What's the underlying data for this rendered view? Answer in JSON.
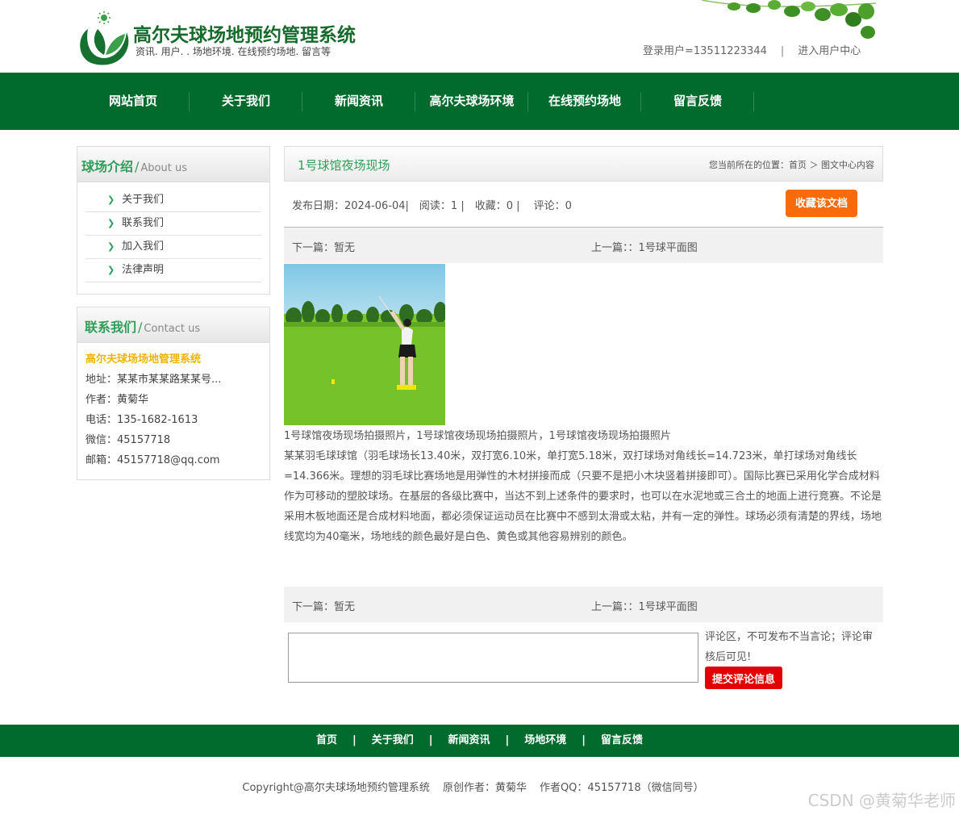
{
  "header": {
    "title": "高尔夫球场地预约管理系统",
    "subtitle": "资讯. 用户. . 场地环境. 在线预约场地. 留言等",
    "login_user": "登录用户=13511223344",
    "separator": "|",
    "user_center": "进入用户中心"
  },
  "nav": [
    "网站首页",
    "关于我们",
    "新闻资讯",
    "高尔夫球场环境",
    "在线预约场地",
    "留言反馈"
  ],
  "sidebar": {
    "about": {
      "title": "球场介绍",
      "slash": "/",
      "en": "About us",
      "items": [
        "关于我们",
        "联系我们",
        "加入我们",
        "法律声明"
      ]
    },
    "contact": {
      "title": "联系我们",
      "slash": "/",
      "en": "Contact us",
      "name": "高尔夫球场场地管理系统",
      "address": "地址：某某市某某路某某号...",
      "author": "作者：黄菊华",
      "phone": "电话：135-1682-1613",
      "wechat": "微信：45157718",
      "email": "邮箱：45157718@qq.com"
    }
  },
  "main": {
    "title": "1号球馆夜场现场",
    "breadcrumb": "您当前所在的位置：首页 ＞ 图文中心内容",
    "meta": "发布日期：2024-06-04|　阅读：1 |　收藏：0 |　 评论：0",
    "fav_button": "收藏该文档",
    "next": "下一篇：暂无",
    "prev": "上一篇：：1号球平面图",
    "caption": "1号球馆夜场现场拍摄照片，1号球馆夜场现场拍摄照片，1号球馆夜场现场拍摄照片",
    "body": "某某羽毛球球馆（羽毛球场长13.40米，双打宽6.10米，单打宽5.18米，双打球场对角线长=14.723米，单打球场对角线长=14.366米。理想的羽毛球比赛场地是用弹性的木材拼接而成（只要不是把小木块竖着拼接即可）。国际比赛已采用化学合成材料作为可移动的塑胶球场。在基层的各级比赛中，当达不到上述条件的要求时，也可以在水泥地或三合土的地面上进行竞赛。不论是采用木板地面还是合成材料地面，都必须保证运动员在比赛中不感到太滑或太粘，并有一定的弹性。球场必须有清楚的界线，场地线宽均为40毫米，场地线的颜色最好是白色、黄色或其他容易辨别的颜色。",
    "comment_note": "评论区，不可发布不当言论；评论审核后可见!",
    "submit": "提交评论信息"
  },
  "footer": {
    "links": [
      "首页",
      "关于我们",
      "新闻资讯",
      "场地环境",
      "留言反馈"
    ],
    "separator": "|",
    "copyright": "Copyright@高尔夫球场地预约管理系统",
    "original_author": "原创作者：黄菊华",
    "qq": "作者QQ：45157718（微信同号）",
    "watermark": "CSDN @黄菊华老师"
  },
  "colors": {
    "nav_green": "#006b2d",
    "title_green": "#2e9e5a",
    "fav_orange": "#f76b0b",
    "submit_red": "#e30000",
    "contact_yellow": "#f0b400"
  }
}
